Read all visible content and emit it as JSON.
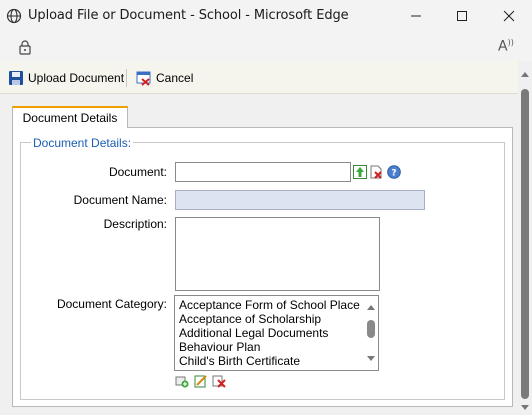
{
  "window": {
    "title": "Upload File or Document - School - Microsoft Edge"
  },
  "toolbar": {
    "upload_label": "Upload Document",
    "cancel_label": "Cancel"
  },
  "tab": {
    "label": "Document Details"
  },
  "form": {
    "legend": "Document Details:",
    "document_label": "Document:",
    "document_value": "",
    "document_name_label": "Document Name:",
    "document_name_value": "",
    "description_label": "Description:",
    "description_value": "",
    "category_label": "Document Category:",
    "categories": [
      "Acceptance Form of School Place",
      "Acceptance of Scholarship",
      "Additional Legal Documents",
      "Behaviour Plan",
      "Child's Birth Certificate"
    ]
  },
  "colors": {
    "accent_link": "#1a5fb4",
    "tab_accent": "#f0a000",
    "readonly_field": "#dde3f0"
  }
}
